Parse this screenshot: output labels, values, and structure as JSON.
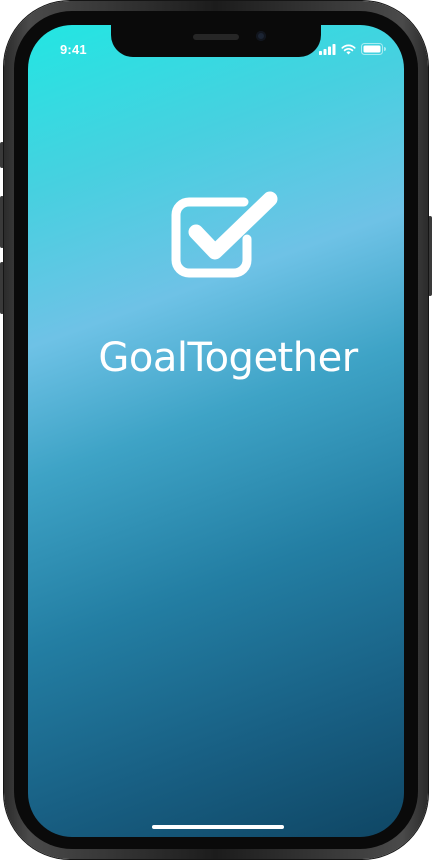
{
  "status_bar": {
    "time": "9:41",
    "icons": [
      "cellular-signal-icon",
      "wifi-icon",
      "battery-icon"
    ]
  },
  "app": {
    "name": "GoalTogether",
    "logo_icon": "checkbox-checked-icon"
  },
  "colors": {
    "gradient_top": "#22e6e2",
    "gradient_mid": "#6ec2e6",
    "gradient_bottom": "#0f4664",
    "text": "#ffffff"
  }
}
